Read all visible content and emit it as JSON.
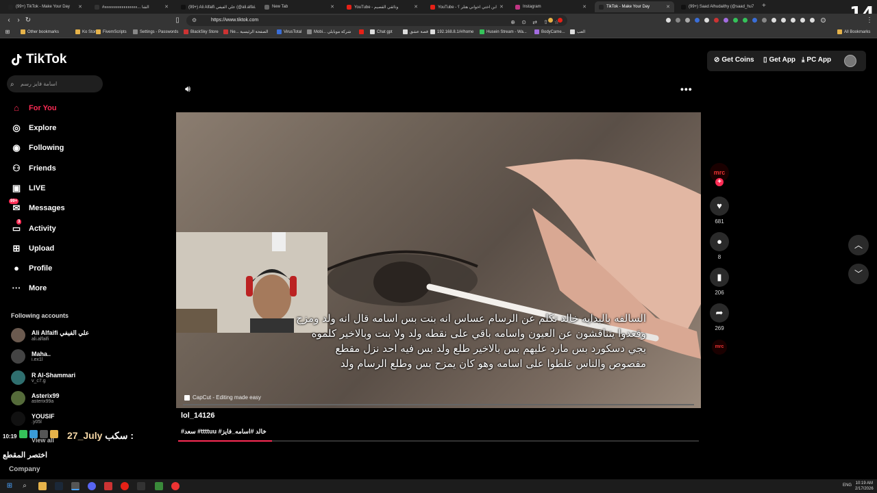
{
  "browser": {
    "tabs": [
      {
        "title": "(99+) TikTok - Make Your Day",
        "color": "#222"
      },
      {
        "title": "#الشا ...ءءءءءءءءءءءءءءءءء",
        "color": "#333"
      },
      {
        "title": "(99+) Ali Alfaifi علي الفيفي (@ali.alfai...",
        "color": "#111"
      },
      {
        "title": "New Tab",
        "color": "#666"
      },
      {
        "title": "YouTube - وثائقي القصيم",
        "color": "#e62117"
      },
      {
        "title": "YouTube - ابن اختي اخواني هتلر ؟",
        "color": "#e62117"
      },
      {
        "title": "Instagram",
        "color": "#c13584"
      },
      {
        "title": "TikTok - Make Your Day",
        "color": "#222",
        "active": true
      },
      {
        "title": "(99+) Saad Alhudaithy (@saad_hu7)",
        "color": "#111"
      }
    ],
    "new_tab": "+",
    "corner_badge": "14",
    "url": "https://www.tiktok.com",
    "bookmarks": [
      {
        "label": "Other bookmarks",
        "color": "#e6b34a"
      },
      {
        "label": "Ko Store",
        "color": "#e6b34a"
      },
      {
        "label": "FivemScripts",
        "color": "#e6b34a"
      },
      {
        "label": "Settings - Passwords",
        "color": "#888"
      },
      {
        "label": "BlackSky Store",
        "color": "#c33"
      },
      {
        "label": "Ne... الصفحة الرئيسية",
        "color": "#c33"
      },
      {
        "label": "VirusTotal",
        "color": "#3a6ed8"
      },
      {
        "label": "Mobi... شركة موبايلي",
        "color": "#888"
      },
      {
        "label": "",
        "color": "#e62117"
      },
      {
        "label": "Chat gpt",
        "color": "#ddd"
      },
      {
        "label": "قصة عشق",
        "color": "#ddd"
      },
      {
        "label": "192.168.8.1/#/home",
        "color": "#ddd"
      },
      {
        "label": "Husein Stream - Wa...",
        "color": "#35c35a"
      },
      {
        "label": "BodyCame...",
        "color": "#a36ce0"
      },
      {
        "label": "العب",
        "color": "#ddd"
      }
    ],
    "all_bookmarks": "All Bookmarks"
  },
  "tiktok": {
    "logo": "TikTok",
    "search_placeholder": "اسامة فايز رسم",
    "nav": [
      {
        "label": "For You",
        "icon": "home-icon",
        "active": true
      },
      {
        "label": "Explore",
        "icon": "compass-icon"
      },
      {
        "label": "Following",
        "icon": "following-icon"
      },
      {
        "label": "Friends",
        "icon": "friends-icon"
      },
      {
        "label": "LIVE",
        "icon": "live-icon"
      },
      {
        "label": "Messages",
        "icon": "messages-icon",
        "badge": "99+"
      },
      {
        "label": "Activity",
        "icon": "activity-icon",
        "badge": "3"
      },
      {
        "label": "Upload",
        "icon": "upload-icon"
      },
      {
        "label": "Profile",
        "icon": "profile-icon"
      },
      {
        "label": "More",
        "icon": "more-icon"
      }
    ],
    "following_title": "Following accounts",
    "accounts": [
      {
        "name": "Ali Alfaifi علي الفيفي",
        "handle": "ali.alfaifi"
      },
      {
        "name": "Maha..",
        "handle": "i.ex1l"
      },
      {
        "name": "R Al-Shammari",
        "handle": "v_c7.g"
      },
      {
        "name": "Asterix99",
        "handle": "asterix99a"
      },
      {
        "name": "YOUSIF",
        "handle": ".y05l"
      }
    ],
    "view_all": "View all",
    "company": "Company",
    "header": {
      "get_coins": "Get Coins",
      "get_app": "Get App",
      "pc_app": "PC App"
    },
    "video": {
      "caption_lines": [
        "السالفه بالبدايه خالد تكلم عن الرسام عساس انه بنت بس اسامه قال انه ولد ومزح",
        "وقعدوا يتناقشون عن العيون واسامه باقي على نقطه ولد ولا بنت وبالاخير كلموه",
        "يجي دسكورد بس مارد عليهم بس بالاخير طلع ولد بس فيه احد نزل مقطع",
        "مقصوص والناس غلطوا على اسامه وهو كان يمزح بس وطلع الرسام ولد"
      ],
      "capcut": "CapCut - Editing made easy",
      "author": "lol_14126",
      "tags": "#سعد #ttttuu #خالد #اسامه_فايز",
      "progress": 0.18
    },
    "actions": {
      "likes": "681",
      "comments": "8",
      "saves": "206",
      "shares": "269"
    }
  },
  "stream_overlay": {
    "time": "10:19",
    "username": "27_July",
    "message": "سكب :",
    "sub": "اختصر المقطع"
  },
  "taskbar": {
    "lang": "ENG",
    "time": "10:19 AM",
    "date": "2/17/2026"
  }
}
